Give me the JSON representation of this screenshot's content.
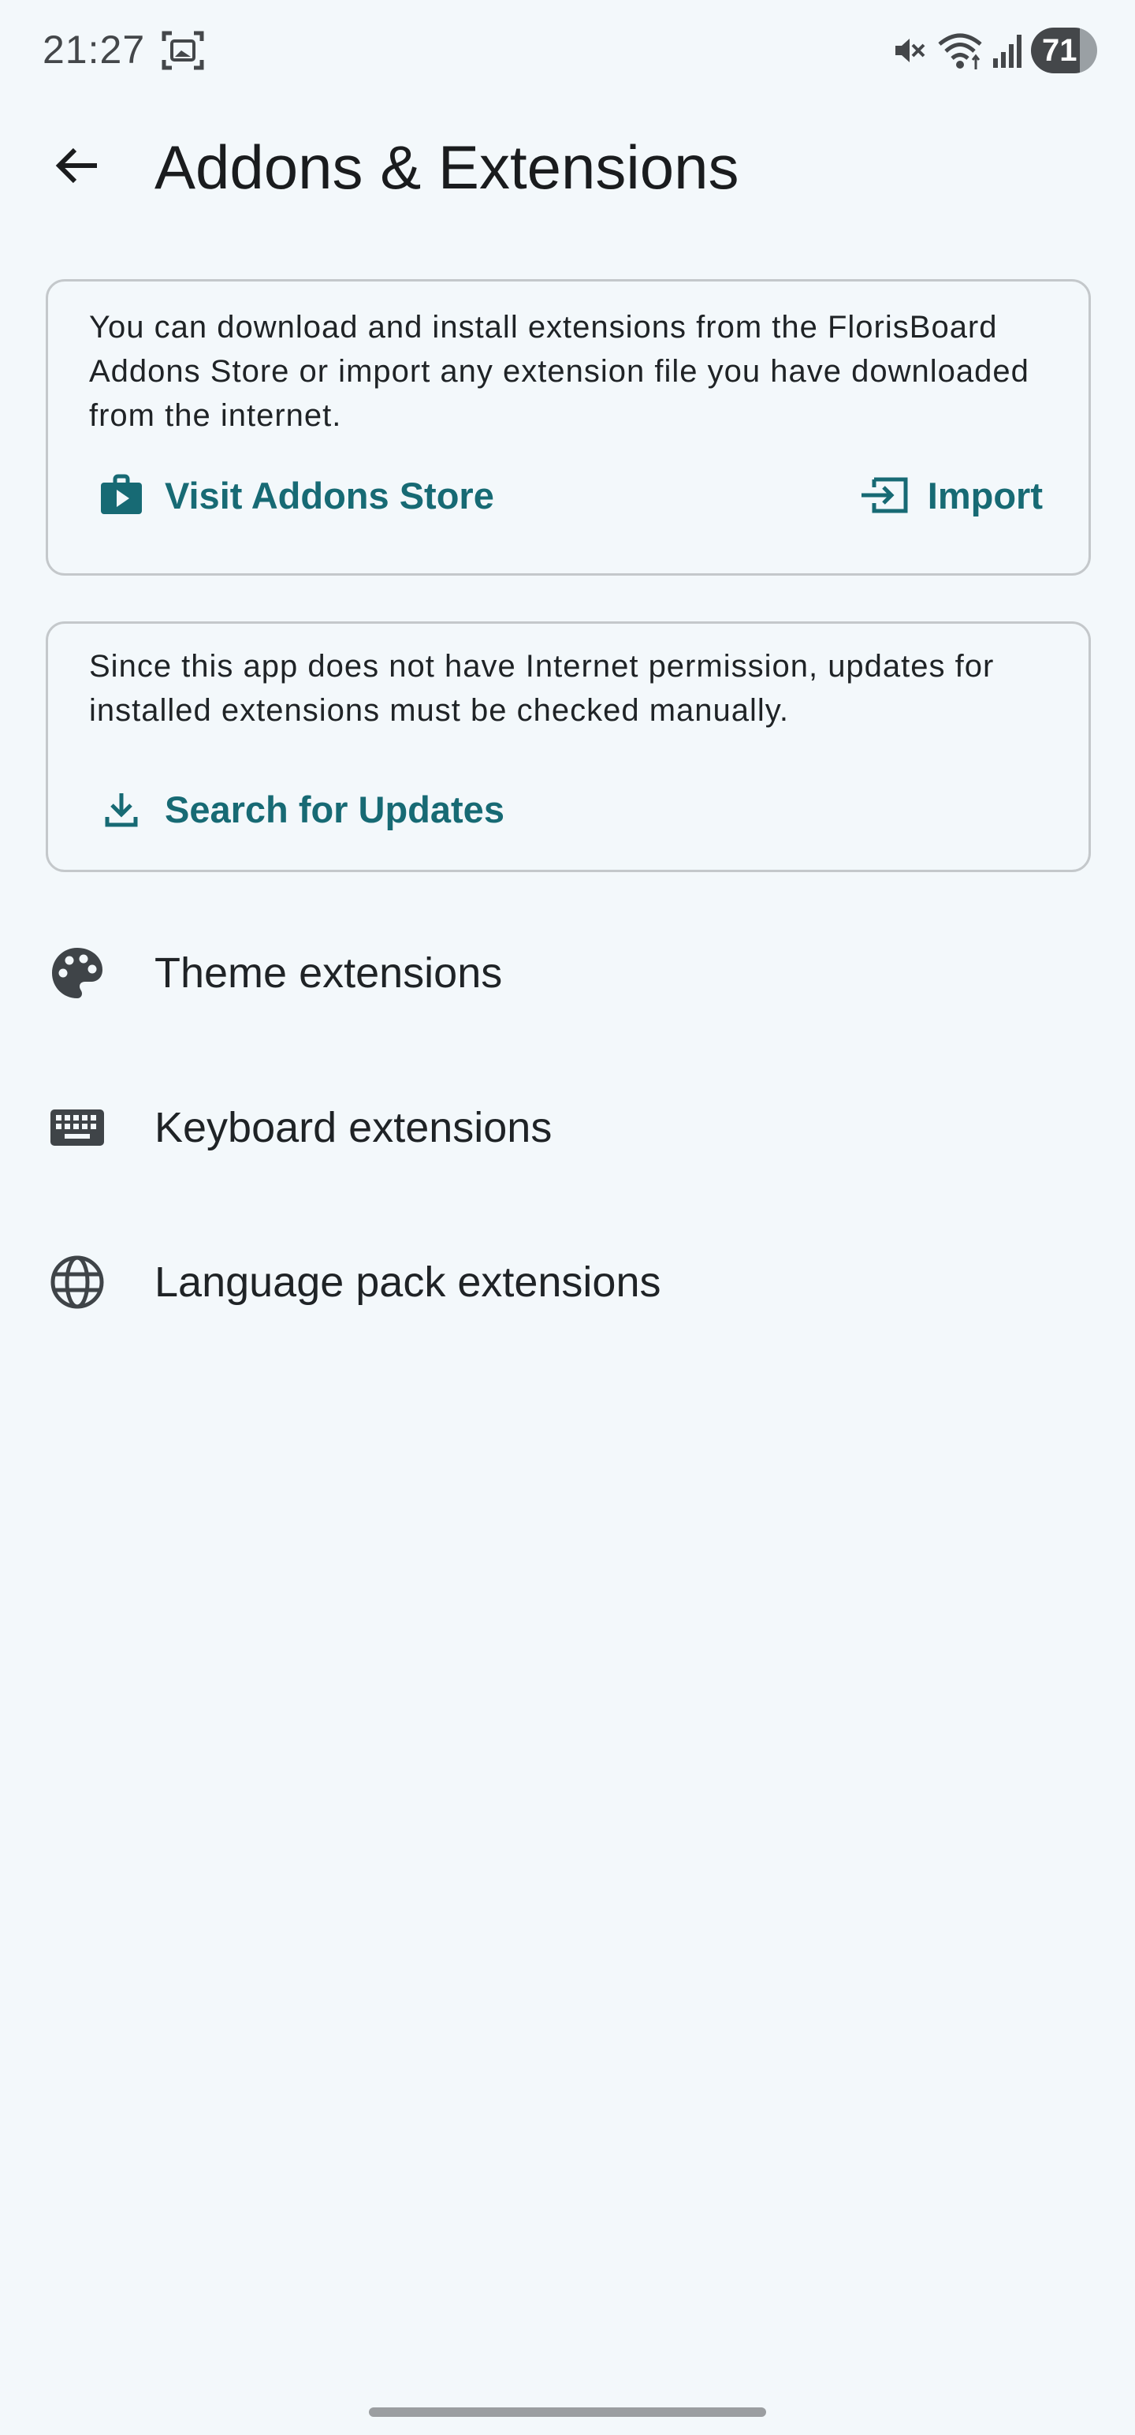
{
  "status_bar": {
    "time": "21:27",
    "battery_level": "71",
    "icons": [
      "screenshot-icon",
      "mute-icon",
      "wifi-icon",
      "signal-icon",
      "battery-icon"
    ]
  },
  "app_bar": {
    "title": "Addons & Extensions",
    "back_icon": "arrow-back-icon"
  },
  "store_card": {
    "text": "You can download and install extensions from the FlorisBoard Addons Store or import any extension file you have downloaded from the internet.",
    "visit_label": "Visit Addons Store",
    "visit_icon": "shop-icon",
    "import_label": "Import",
    "import_icon": "import-icon"
  },
  "updates_card": {
    "text": "Since this app does not have Internet permission, updates for installed extensions must be checked manually.",
    "search_label": "Search for Updates",
    "search_icon": "download-icon"
  },
  "extensions": [
    {
      "label": "Theme extensions",
      "icon": "palette-icon"
    },
    {
      "label": "Keyboard extensions",
      "icon": "keyboard-icon"
    },
    {
      "label": "Language pack extensions",
      "icon": "globe-icon"
    }
  ],
  "colors": {
    "background": "#f3f8fb",
    "accent": "#176a74",
    "text": "#1a1c1e",
    "card_border": "#c4c8cb",
    "icon_dark": "#3f4448"
  }
}
